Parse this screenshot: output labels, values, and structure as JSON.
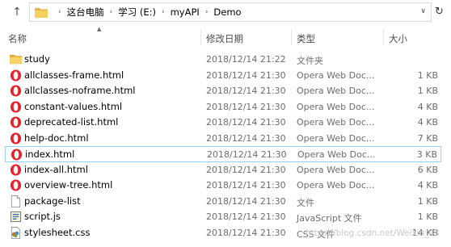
{
  "address": {
    "path": [
      "这台电脑",
      "学习 (E:)",
      "myAPI",
      "Demo"
    ]
  },
  "columns": {
    "name": "名称",
    "date": "修改日期",
    "type": "类型",
    "size": "大小"
  },
  "files": [
    {
      "name": "study",
      "date": "2018/12/14 21:22",
      "type": "文件夹",
      "size": "",
      "icon": "folder-icon"
    },
    {
      "name": "allclasses-frame.html",
      "date": "2018/12/14 21:30",
      "type": "Opera Web Doc...",
      "size": "1 KB",
      "icon": "opera-icon"
    },
    {
      "name": "allclasses-noframe.html",
      "date": "2018/12/14 21:30",
      "type": "Opera Web Doc...",
      "size": "1 KB",
      "icon": "opera-icon"
    },
    {
      "name": "constant-values.html",
      "date": "2018/12/14 21:30",
      "type": "Opera Web Doc...",
      "size": "4 KB",
      "icon": "opera-icon"
    },
    {
      "name": "deprecated-list.html",
      "date": "2018/12/14 21:30",
      "type": "Opera Web Doc...",
      "size": "4 KB",
      "icon": "opera-icon"
    },
    {
      "name": "help-doc.html",
      "date": "2018/12/14 21:30",
      "type": "Opera Web Doc...",
      "size": "7 KB",
      "icon": "opera-icon"
    },
    {
      "name": "index.html",
      "date": "2018/12/14 21:30",
      "type": "Opera Web Doc...",
      "size": "3 KB",
      "icon": "opera-icon",
      "selected": true
    },
    {
      "name": "index-all.html",
      "date": "2018/12/14 21:30",
      "type": "Opera Web Doc...",
      "size": "6 KB",
      "icon": "opera-icon"
    },
    {
      "name": "overview-tree.html",
      "date": "2018/12/14 21:30",
      "type": "Opera Web Doc...",
      "size": "4 KB",
      "icon": "opera-icon"
    },
    {
      "name": "package-list",
      "date": "2018/12/14 21:30",
      "type": "文件",
      "size": "1 KB",
      "icon": "file-icon"
    },
    {
      "name": "script.js",
      "date": "2018/12/14 21:30",
      "type": "JavaScript 文件",
      "size": "1 KB",
      "icon": "script-icon"
    },
    {
      "name": "stylesheet.css",
      "date": "2018/12/14 21:30",
      "type": "CSS 文件",
      "size": "14 KB",
      "icon": "css-icon"
    }
  ],
  "watermark": "https://blog.csdn.net/Weixin_43"
}
